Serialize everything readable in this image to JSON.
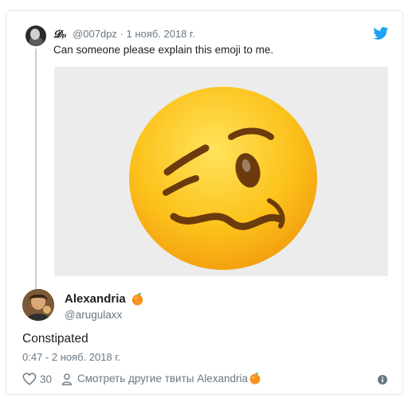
{
  "parent_tweet": {
    "author_name": "𝓓ₚ",
    "handle": "@007dpz",
    "separator": "·",
    "date": "1 нояб. 2018 г.",
    "text": "Can someone please explain this emoji to me.",
    "media_icon": "woozy-face-emoji"
  },
  "reply_tweet": {
    "author_name": "Alexandria",
    "handle": "@arugulaxx",
    "text": "Constipated",
    "timestamp": "0:47 - 2 нояб. 2018 г.",
    "like_count": "30",
    "more_link": "Смотреть другие твиты Alexandria",
    "name_badge_icon": "tangerine-emoji"
  },
  "icons": {
    "brand": "twitter-bird-icon",
    "like": "heart-icon",
    "more": "person-icon",
    "info": "info-icon"
  },
  "colors": {
    "brand_blue": "#1da1f2",
    "muted_text": "#697882",
    "thread_line": "#c4cfd6",
    "emoji_yellow": "#fdc12a",
    "media_background": "#ececec"
  }
}
